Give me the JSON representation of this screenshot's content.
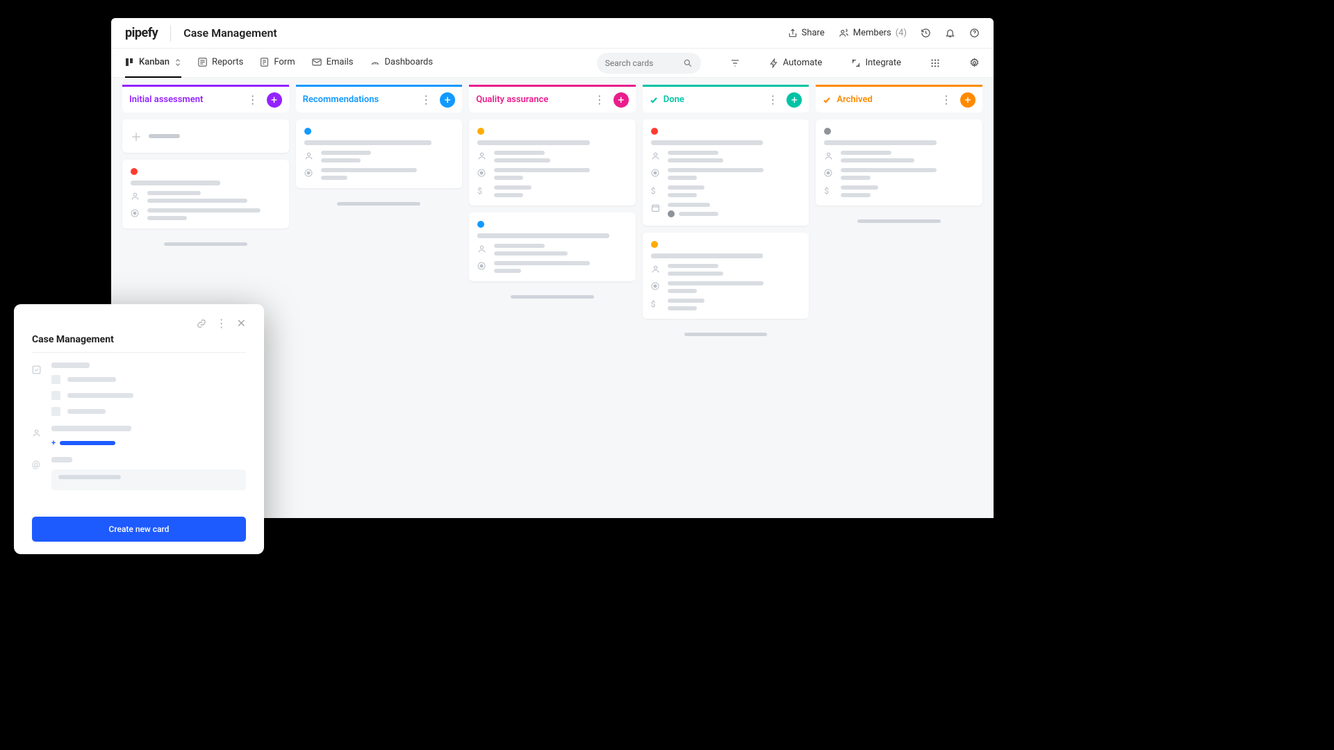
{
  "header": {
    "logo": "pipefy",
    "title": "Case Management",
    "share": "Share",
    "members": "Members",
    "members_count": "(4)"
  },
  "tabs": {
    "kanban": "Kanban",
    "reports": "Reports",
    "form": "Form",
    "emails": "Emails",
    "dashboards": "Dashboards"
  },
  "toolbar": {
    "search_placeholder": "Search cards",
    "automate": "Automate",
    "integrate": "Integrate"
  },
  "columns": [
    {
      "name": "Initial assessment",
      "color": "purple",
      "check": false
    },
    {
      "name": "Recommendations",
      "color": "blue",
      "check": false
    },
    {
      "name": "Quality assurance",
      "color": "pink",
      "check": false
    },
    {
      "name": "Done",
      "color": "teal",
      "check": true
    },
    {
      "name": "Archived",
      "color": "orange",
      "check": true
    }
  ],
  "status_colors": {
    "red": "#ff3b30",
    "blue": "#1299ff",
    "orange": "#ffab00",
    "gray": "#8e9399"
  },
  "modal": {
    "title": "Case Management",
    "create_btn": "Create new card"
  }
}
